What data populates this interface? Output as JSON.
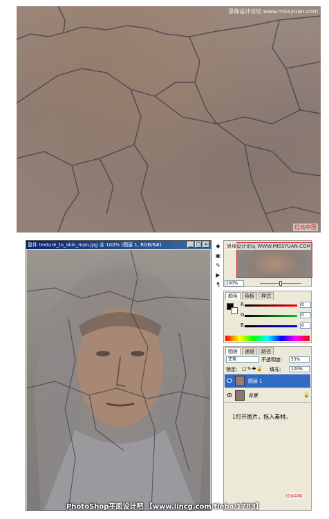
{
  "top_image": {
    "watermark_text": "思缘设计论坛 www.missyuan.com",
    "watermark_logo": "红动中国"
  },
  "document_window": {
    "title": "复件 texture_to_skin_man.jpg @ 100% (图层 1, RGB/8#)",
    "minimize_glyph": "_",
    "maximize_glyph": "□",
    "close_glyph": "×"
  },
  "navigator": {
    "watermark": "思缘设计论坛 WWW.MISSYUAN.COM",
    "zoom": "100%"
  },
  "color_panel": {
    "tabs": [
      "颜色",
      "色板",
      "样式"
    ],
    "channels": [
      {
        "label": "R",
        "value": "0"
      },
      {
        "label": "G",
        "value": "0"
      },
      {
        "label": "B",
        "value": "0"
      }
    ],
    "foreground": "#000000",
    "background": "#ffffff"
  },
  "layers_panel": {
    "tabs": [
      "图层",
      "通道",
      "路径"
    ],
    "blend_mode": "正常",
    "opacity_label": "不透明度:",
    "opacity_value": "53%",
    "lock_label": "锁定:",
    "fill_label": "填充:",
    "fill_value": "100%",
    "layers": [
      {
        "name": "图层 1",
        "selected": true
      },
      {
        "name": "背景",
        "selected": false,
        "locked": true
      }
    ],
    "note": "1打开图片，拖入素材。"
  },
  "bottom_banner": "PhotoShop平面设计吧 【www.lincg.com/tieba/1783】",
  "bottom_logo": "红动中国"
}
